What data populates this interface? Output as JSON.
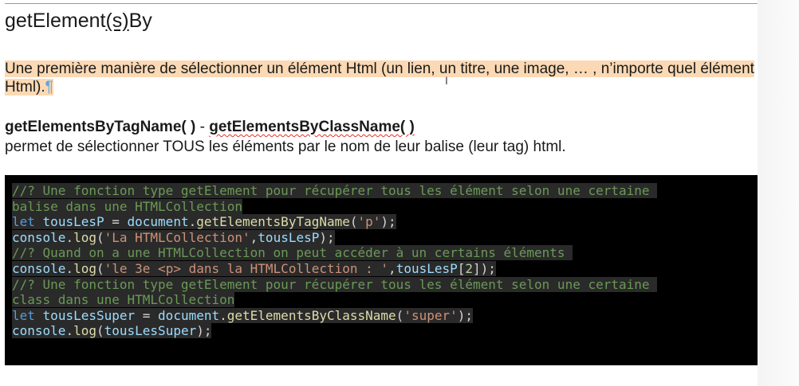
{
  "heading": {
    "before": "getElement",
    "underlined": "(s)",
    "after": "By"
  },
  "intro": {
    "text": "Une première manière de sélectionner un élément Html (un lien, un titre, une image, … , n’importe quel élément Html).",
    "pilcrow": "¶"
  },
  "cursor_glyph": "I",
  "method": {
    "name1": "getElementsByTagName( )",
    "separator": " - ",
    "name2": "getElementsByClassName( )",
    "description": "permet de sélectionner TOUS les éléments par le nom de leur balise (leur tag) html."
  },
  "code_lines": [
    [
      {
        "t": "//? Une fonction type getElement pour récupérer tous les élément selon une certaine ",
        "c": "comment"
      }
    ],
    [
      {
        "t": "balise dans une HTMLCollection",
        "c": "comment"
      }
    ],
    [
      {
        "t": "let",
        "c": "keyword"
      },
      {
        "t": " ",
        "c": "plain"
      },
      {
        "t": "tousLesP",
        "c": "var"
      },
      {
        "t": " = ",
        "c": "plain"
      },
      {
        "t": "document",
        "c": "var"
      },
      {
        "t": ".",
        "c": "plain"
      },
      {
        "t": "getElementsByTagName",
        "c": "func"
      },
      {
        "t": "(",
        "c": "plain"
      },
      {
        "t": "'p'",
        "c": "string"
      },
      {
        "t": ");",
        "c": "plain"
      }
    ],
    [
      {
        "t": "console",
        "c": "var"
      },
      {
        "t": ".",
        "c": "plain"
      },
      {
        "t": "log",
        "c": "func"
      },
      {
        "t": "(",
        "c": "plain"
      },
      {
        "t": "'La HTMLCollection'",
        "c": "string"
      },
      {
        "t": ",",
        "c": "plain"
      },
      {
        "t": "tousLesP",
        "c": "var"
      },
      {
        "t": ");",
        "c": "plain"
      }
    ],
    [
      {
        "t": "//? Quand on a une HTMLCollection on peut accéder à un certains éléments ",
        "c": "comment"
      }
    ],
    [
      {
        "t": "console",
        "c": "var"
      },
      {
        "t": ".",
        "c": "plain"
      },
      {
        "t": "log",
        "c": "func"
      },
      {
        "t": "(",
        "c": "plain"
      },
      {
        "t": "'le 3e <p> dans la HTMLCollection : '",
        "c": "string"
      },
      {
        "t": ",",
        "c": "plain"
      },
      {
        "t": "tousLesP",
        "c": "var"
      },
      {
        "t": "[",
        "c": "plain"
      },
      {
        "t": "2",
        "c": "number"
      },
      {
        "t": "]);",
        "c": "plain"
      }
    ],
    [
      {
        "t": "//? Une fonction type getElement pour récupérer tous les élément selon une certaine ",
        "c": "comment"
      }
    ],
    [
      {
        "t": "class dans une HTMLCollection",
        "c": "comment"
      }
    ],
    [
      {
        "t": "let",
        "c": "keyword"
      },
      {
        "t": " ",
        "c": "plain"
      },
      {
        "t": "tousLesSuper",
        "c": "var"
      },
      {
        "t": " = ",
        "c": "plain"
      },
      {
        "t": "document",
        "c": "var"
      },
      {
        "t": ".",
        "c": "plain"
      },
      {
        "t": "getElementsByClassName",
        "c": "func"
      },
      {
        "t": "(",
        "c": "plain"
      },
      {
        "t": "'super'",
        "c": "string"
      },
      {
        "t": ");",
        "c": "plain"
      }
    ],
    [
      {
        "t": "console",
        "c": "var"
      },
      {
        "t": ".",
        "c": "plain"
      },
      {
        "t": "log",
        "c": "func"
      },
      {
        "t": "(",
        "c": "plain"
      },
      {
        "t": "tousLesSuper",
        "c": "var"
      },
      {
        "t": ");",
        "c": "plain"
      }
    ]
  ],
  "colors": {
    "highlight": "#fbd9b4",
    "pilcrow": "#5aa7e0",
    "spellcheck": "#e0322d",
    "code_background": "#000000"
  }
}
